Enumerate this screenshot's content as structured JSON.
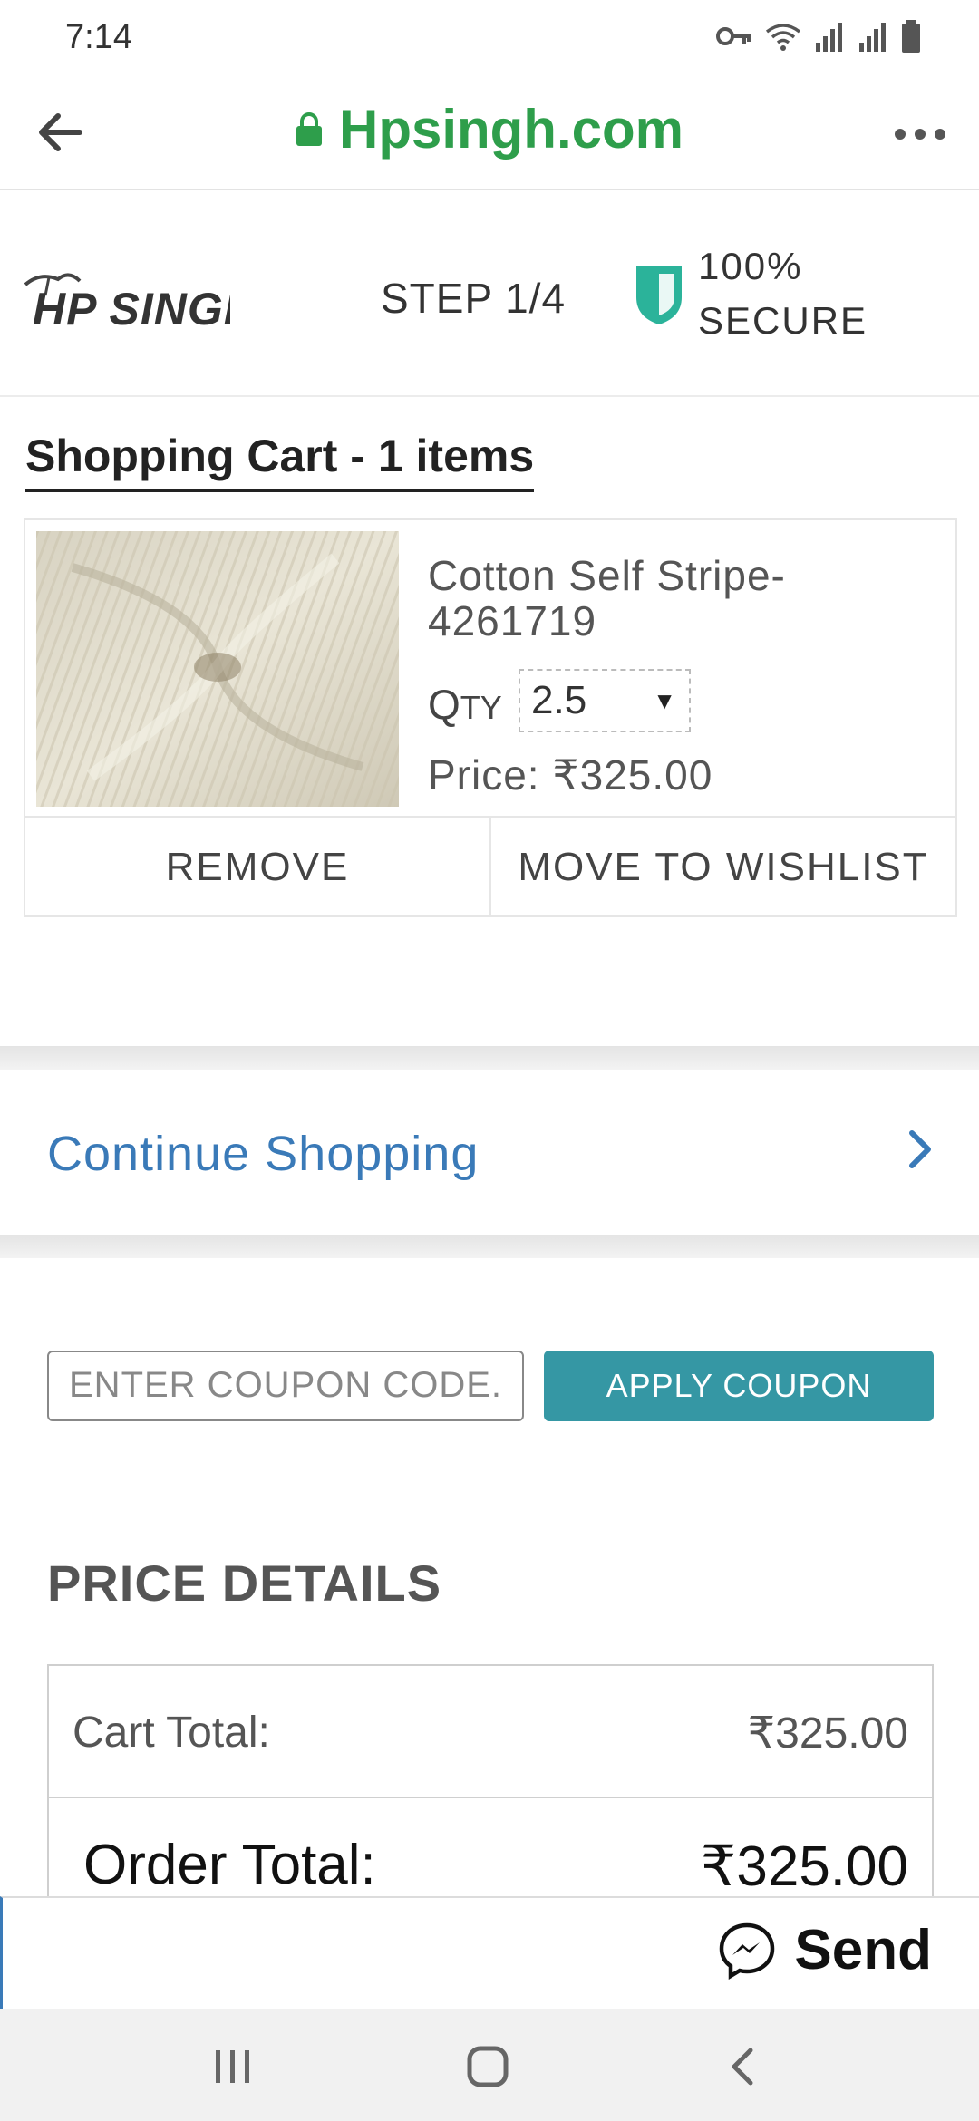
{
  "status_bar": {
    "time": "7:14"
  },
  "browser": {
    "url": "Hpsingh.com"
  },
  "header": {
    "logo_text": "HP SINGH",
    "step": "STEP 1/4",
    "secure_line1": "100%",
    "secure_line2": "SECURE"
  },
  "cart": {
    "heading": "Shopping Cart - 1 items",
    "item": {
      "title": "Cotton Self Stripe-4261719",
      "qty_label_first": "Q",
      "qty_label_rest": "TY",
      "qty_value": "2.5",
      "price": "Price: ₹325.00",
      "remove_label": "REMOVE",
      "wishlist_label": "MOVE TO WISHLIST"
    }
  },
  "continue_shopping": "Continue Shopping",
  "coupon": {
    "placeholder": "ENTER COUPON CODE.",
    "apply_label": "APPLY COUPON"
  },
  "price_details": {
    "heading": "PRICE DETAILS",
    "cart_total_label": "Cart Total:",
    "cart_total_value": "₹325.00",
    "order_total_label": "Order Total:",
    "order_total_value": "₹325.00"
  },
  "send_bar": {
    "label": "Send"
  },
  "colors": {
    "url_green": "#2e9e4b",
    "link_blue": "#3a7ab8",
    "coupon_button": "#3597a4",
    "shield": "#2bb39a"
  }
}
